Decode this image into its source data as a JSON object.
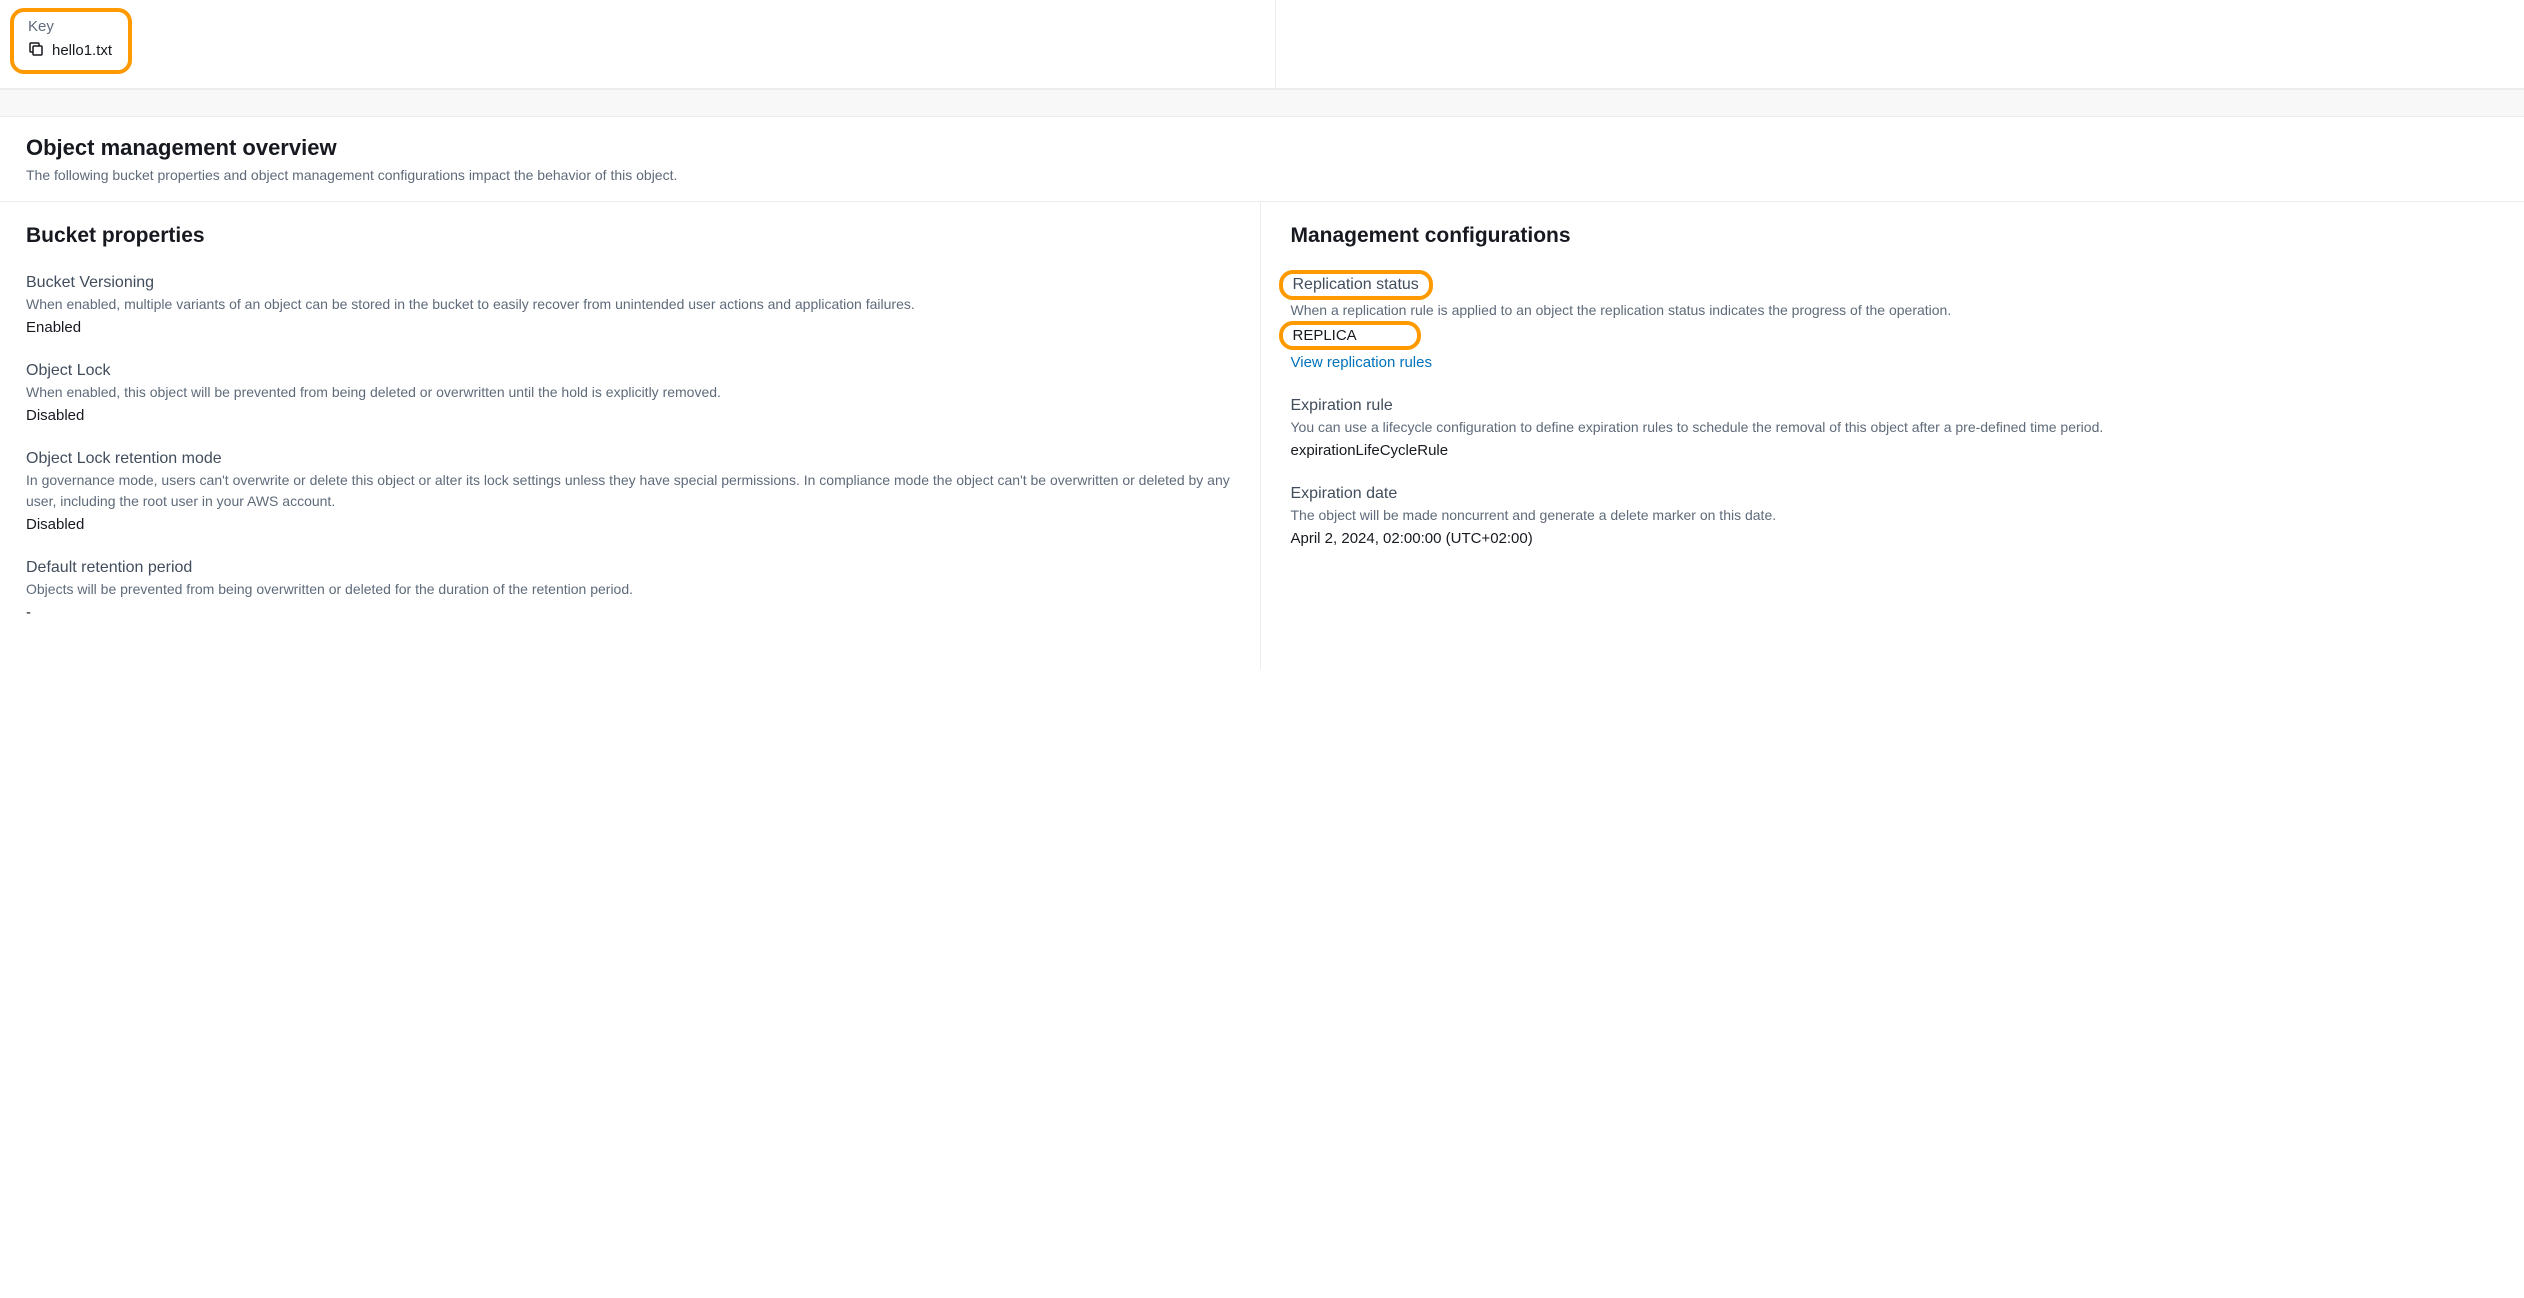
{
  "key": {
    "label": "Key",
    "value": "hello1.txt"
  },
  "overview": {
    "title": "Object management overview",
    "description": "The following bucket properties and object management configurations impact the behavior of this object."
  },
  "bucketProperties": {
    "title": "Bucket properties",
    "versioning": {
      "label": "Bucket Versioning",
      "description": "When enabled, multiple variants of an object can be stored in the bucket to easily recover from unintended user actions and application failures.",
      "value": "Enabled"
    },
    "objectLock": {
      "label": "Object Lock",
      "description": "When enabled, this object will be prevented from being deleted or overwritten until the hold is explicitly removed.",
      "value": "Disabled"
    },
    "retentionMode": {
      "label": "Object Lock retention mode",
      "description": "In governance mode, users can't overwrite or delete this object or alter its lock settings unless they have special permissions. In compliance mode the object can't be overwritten or deleted by any user, including the root user in your AWS account.",
      "value": "Disabled"
    },
    "retentionPeriod": {
      "label": "Default retention period",
      "description": "Objects will be prevented from being overwritten or deleted for the duration of the retention period.",
      "value": "-"
    }
  },
  "managementConfigurations": {
    "title": "Management configurations",
    "replicationStatus": {
      "label": "Replication status",
      "description": "When a replication rule is applied to an object the replication status indicates the progress of the operation.",
      "value": "REPLICA",
      "link": "View replication rules"
    },
    "expirationRule": {
      "label": "Expiration rule",
      "description": "You can use a lifecycle configuration to define expiration rules to schedule the removal of this object after a pre-defined time period.",
      "value": "expirationLifeCycleRule"
    },
    "expirationDate": {
      "label": "Expiration date",
      "description": "The object will be made noncurrent and generate a delete marker on this date.",
      "value": "April 2, 2024, 02:00:00 (UTC+02:00)"
    }
  }
}
